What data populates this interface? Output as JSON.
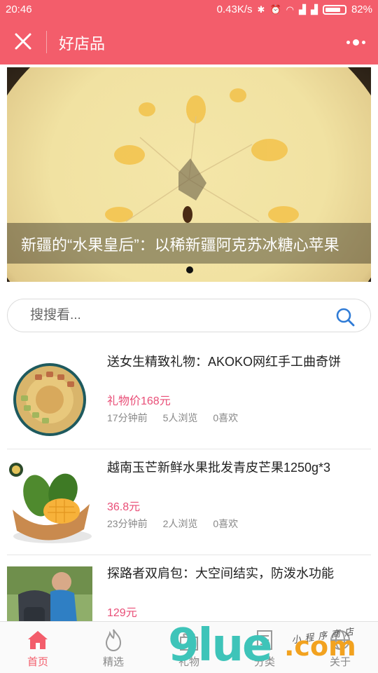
{
  "status_bar": {
    "time": "20:46",
    "network_speed": "0.43K/s",
    "battery": "82%",
    "battery_level": 0.82
  },
  "nav": {
    "title": "好店品",
    "close_icon": "close-icon",
    "more_icon": "more-icon"
  },
  "banner": {
    "caption": "新疆的“水果皇后”：以稀新疆阿克苏冰糖心苹果",
    "active_slide": 1,
    "slide_count": 1
  },
  "search": {
    "placeholder": "搜搜看..."
  },
  "products": [
    {
      "title": "送女生精致礼物：AKOKO网红手工曲奇饼",
      "price": "礼物价168元",
      "time": "17分钟前",
      "views": "5人浏览",
      "likes": "0喜欢"
    },
    {
      "title": "越南玉芒新鲜水果批发青皮芒果1250g*3",
      "price": "36.8元",
      "time": "23分钟前",
      "views": "2人浏览",
      "likes": "0喜欢"
    },
    {
      "title": "探路者双肩包：大空间结实，防泼水功能",
      "price": "129元",
      "time": "",
      "views": "",
      "likes": ""
    }
  ],
  "tabs": [
    {
      "label": "首页",
      "icon": "home-icon",
      "active": true
    },
    {
      "label": "精选",
      "icon": "flame-icon",
      "active": false
    },
    {
      "label": "礼物",
      "icon": "gift-icon",
      "active": false
    },
    {
      "label": "分类",
      "icon": "category-icon",
      "active": false
    },
    {
      "label": "关于",
      "icon": "globe-icon",
      "active": false
    }
  ],
  "watermark": {
    "big": "9lue",
    "com": ".com",
    "small": "小程序商店"
  },
  "colors": {
    "brand": "#f35d6b",
    "price": "#e94e77"
  }
}
